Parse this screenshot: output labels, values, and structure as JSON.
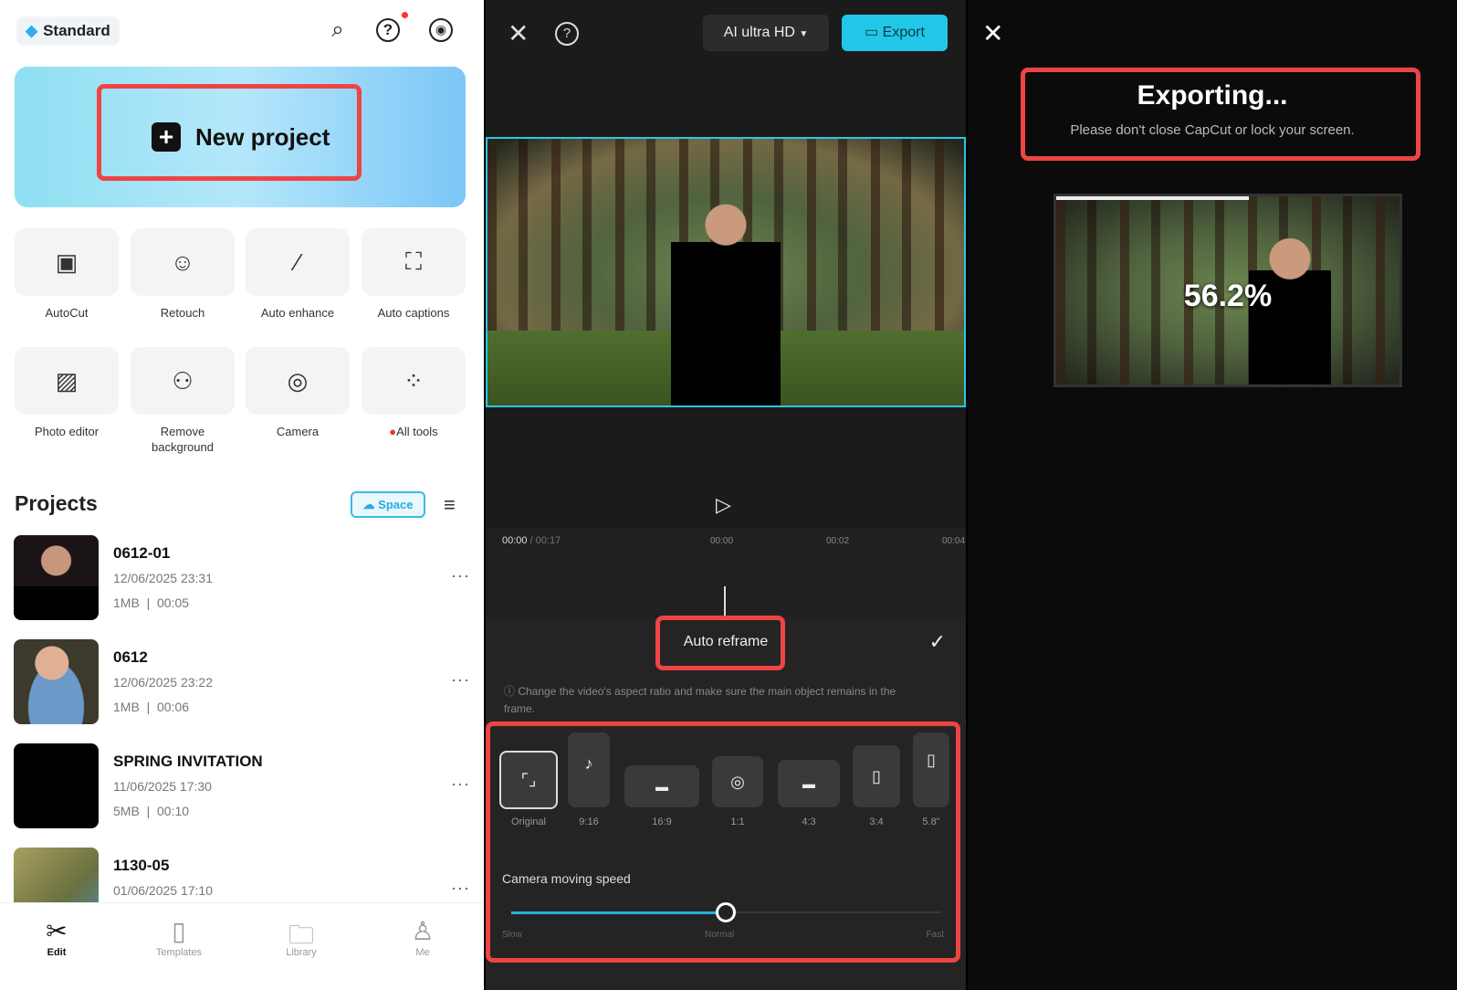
{
  "left": {
    "plan_badge": "Standard",
    "new_project": "New project",
    "tools": [
      {
        "label": "AutoCut",
        "icon": "autocut-icon"
      },
      {
        "label": "Retouch",
        "icon": "retouch-icon"
      },
      {
        "label": "Auto enhance",
        "icon": "magic-wand-icon"
      },
      {
        "label": "Auto captions",
        "icon": "captions-icon"
      },
      {
        "label": "Photo editor",
        "icon": "photo-editor-icon"
      },
      {
        "label": "Remove background",
        "icon": "remove-bg-icon"
      },
      {
        "label": "Camera",
        "icon": "camera-icon"
      },
      {
        "label": "All tools",
        "icon": "grid-icon"
      }
    ],
    "projects_title": "Projects",
    "space_label": "Space",
    "projects": [
      {
        "name": "0612-01",
        "date": "12/06/2025 23:31",
        "meta": "1MB  |  00:05"
      },
      {
        "name": "0612",
        "date": "12/06/2025 23:22",
        "meta": "1MB  |  00:06"
      },
      {
        "name": "SPRING INVITATION",
        "date": "11/06/2025 17:30",
        "meta": "5MB  |  00:10"
      },
      {
        "name": "1130-05",
        "date": "01/06/2025 17:10",
        "meta": ""
      }
    ],
    "nav": [
      {
        "label": "Edit",
        "active": true
      },
      {
        "label": "Templates"
      },
      {
        "label": "Library"
      },
      {
        "label": "Me"
      }
    ]
  },
  "mid": {
    "quality": "AI ultra HD",
    "export": "Export",
    "time_current": "00:00",
    "time_total": "00:17",
    "ticks": [
      "00:00",
      "00:02",
      "00:04"
    ],
    "panel_title": "Auto reframe",
    "info": "Change the video's aspect ratio and make sure the main object remains in the frame.",
    "ratios": [
      "Original",
      "9:16",
      "16:9",
      "1:1",
      "4:3",
      "3:4",
      "5.8\""
    ],
    "speed_label": "Camera moving speed",
    "speed_marks": [
      "Slow",
      "Normal",
      "Fast"
    ],
    "speed_value": 0.5
  },
  "right": {
    "title": "Exporting...",
    "subtitle": "Please don't close CapCut or lock your screen.",
    "progress": "56.2%",
    "progress_value": 0.562
  },
  "colors": {
    "accent": "#22c6e6",
    "highlight": "#ee4444"
  }
}
